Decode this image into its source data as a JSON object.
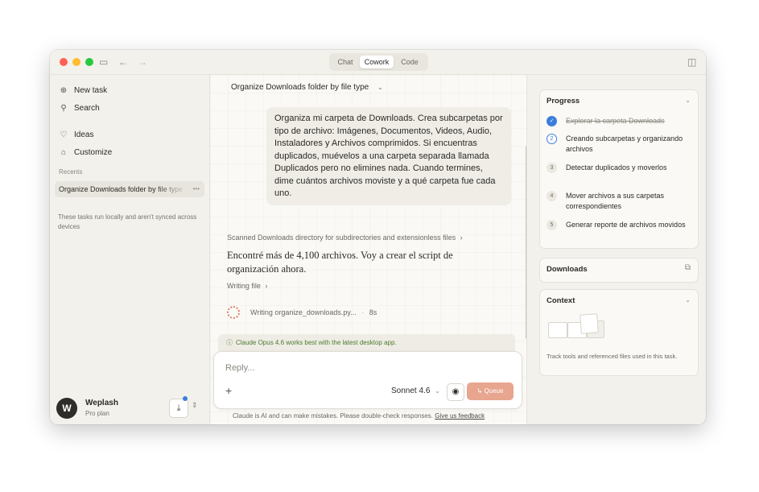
{
  "window": {
    "tabs": [
      {
        "label": "Chat",
        "active": false
      },
      {
        "label": "Cowork",
        "active": true
      },
      {
        "label": "Code",
        "active": false
      }
    ]
  },
  "sidebar": {
    "items": [
      {
        "label": "New task",
        "icon": "plus-icon"
      },
      {
        "label": "Search",
        "icon": "search-icon"
      },
      {
        "label": "Ideas",
        "icon": "lightbulb-icon"
      },
      {
        "label": "Customize",
        "icon": "briefcase-icon"
      }
    ],
    "recents_label": "Recents",
    "recent_item": "Organize Downloads folder by file type",
    "note": "These tasks run locally and aren't synced across devices",
    "user": {
      "initial": "W",
      "name": "Weplash",
      "plan": "Pro plan"
    }
  },
  "main": {
    "task_title": "Organize Downloads folder by file type",
    "user_message": "Organiza mi carpeta de Downloads. Crea subcarpetas por tipo de archivo: Imágenes, Documentos, Videos, Audio, Instaladores y Archivos comprimidos. Si encuentras duplicados, muévelos a una carpeta separada llamada Duplicados pero no elimines nada. Cuando termines, dime cuántos archivos moviste y a qué carpeta fue cada uno.",
    "step_line": "Scanned Downloads directory for subdirectories and extensionless files",
    "assistant_text": "Encontré más de 4,100 archivos. Voy a crear el script de organización ahora.",
    "writing_file": "Writing file",
    "writing_status": "Writing organize_downloads.py...",
    "writing_time": "8s",
    "notice": "Claude Opus 4.6 works best with the latest desktop app.",
    "composer": {
      "placeholder": "Reply...",
      "model": "Sonnet 4.6",
      "queue_label": "Queue"
    },
    "disclaimer": "Claude is AI and can make mistakes. Please double-check responses.",
    "feedback_link": "Give us feedback"
  },
  "right_panel": {
    "progress_title": "Progress",
    "steps": [
      {
        "num": "✓",
        "label": "Explorar la carpeta Downloads",
        "state": "done"
      },
      {
        "num": "2",
        "label": "Creando subcarpetas y organizando archivos",
        "state": "current"
      },
      {
        "num": "3",
        "label": "Detectar duplicados y moverlos",
        "state": "pending"
      },
      {
        "num": "4",
        "label": "Mover archivos a sus carpetas correspondientes",
        "state": "pending"
      },
      {
        "num": "5",
        "label": "Generar reporte de archivos movidos",
        "state": "pending"
      }
    ],
    "downloads_title": "Downloads",
    "context_title": "Context",
    "context_note": "Track tools and referenced files used in this task."
  },
  "colors": {
    "accent": "#3b7ddd",
    "queue": "#e8a58f",
    "notice_text": "#4c7a2f"
  }
}
